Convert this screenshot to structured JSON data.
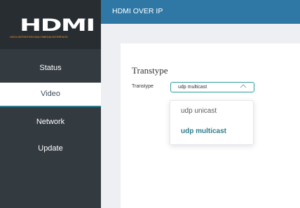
{
  "logo": {
    "wordmark": "HDMI",
    "trademark": "TM",
    "tagline": "HIGH-DEFINITION MULTIMEDIA INTERFACE"
  },
  "sidebar": {
    "items": [
      {
        "label": "Status",
        "active": false
      },
      {
        "label": "Video",
        "active": true
      },
      {
        "label": "Network",
        "active": false
      },
      {
        "label": "Update",
        "active": false
      }
    ]
  },
  "header": {
    "title": "HDMI OVER IP"
  },
  "main": {
    "heading": "Transtype",
    "field": {
      "label": "Transtype",
      "value": "udp multicast",
      "chevron_icon": "chevron-up-icon",
      "options": [
        {
          "label": "udp unicast",
          "selected": false
        },
        {
          "label": "udp multicast",
          "selected": true
        }
      ]
    }
  },
  "colors": {
    "sidebar": "#333a40",
    "logo_bg": "#272d31",
    "header": "#2f78a6",
    "accent": "#2f7d8c",
    "content_bg": "#edeff2"
  }
}
